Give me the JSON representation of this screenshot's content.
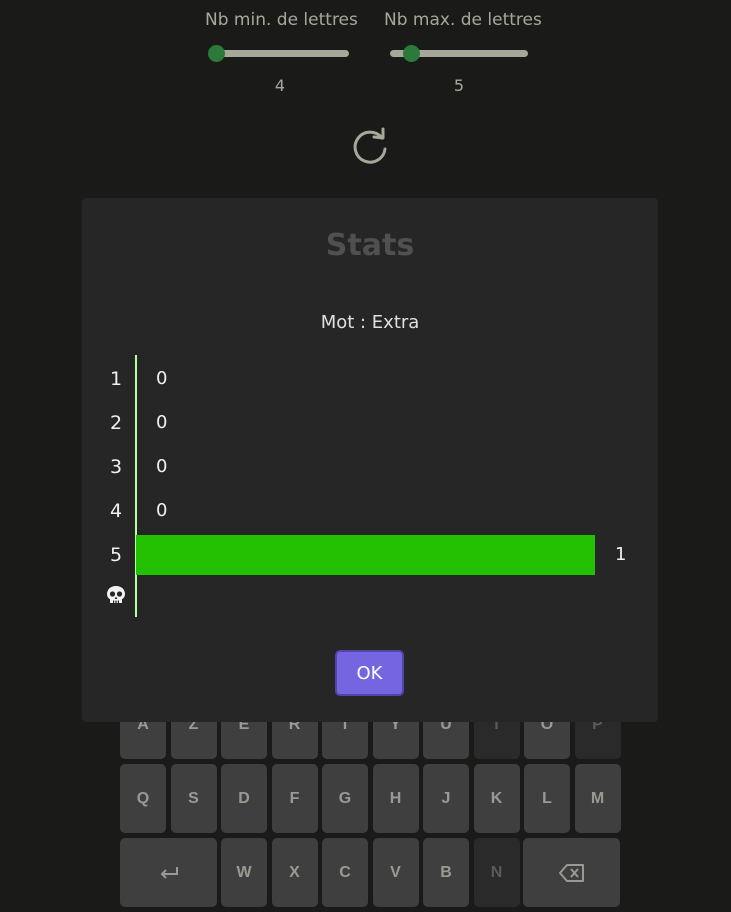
{
  "sliders": {
    "min": {
      "label": "Nb min. de lettres",
      "value": "4",
      "range_min": 4,
      "range_max": 12
    },
    "max": {
      "label": "Nb max. de lettres",
      "value": "5",
      "range_min": 4,
      "range_max": 12
    }
  },
  "icons": {
    "refresh": "refresh-icon",
    "skull": "skull-icon",
    "enter": "enter-icon",
    "backspace": "backspace-icon"
  },
  "modal": {
    "title": "Stats",
    "word": "Mot : Extra",
    "ok_label": "OK"
  },
  "chart_data": {
    "type": "bar",
    "orientation": "horizontal",
    "categories": [
      "1",
      "2",
      "3",
      "4",
      "5",
      "💀"
    ],
    "values": [
      0,
      0,
      0,
      0,
      1,
      null
    ],
    "value_labels": [
      "0",
      "0",
      "0",
      "0",
      "1",
      ""
    ],
    "bar_color": "#22c000"
  },
  "keyboard": {
    "rows": [
      [
        "A",
        "Z",
        "E",
        "R",
        "T",
        "Y",
        "U",
        "I",
        "O",
        "P"
      ],
      [
        "Q",
        "S",
        "D",
        "F",
        "G",
        "H",
        "J",
        "K",
        "L",
        "M"
      ],
      [
        "W",
        "X",
        "C",
        "V",
        "B",
        "N"
      ]
    ],
    "used_keys": [
      "I",
      "P",
      "N"
    ]
  },
  "colors": {
    "accent": "#7565e0",
    "success": "#22c000",
    "slider_thumb": "#2c7a3a"
  }
}
